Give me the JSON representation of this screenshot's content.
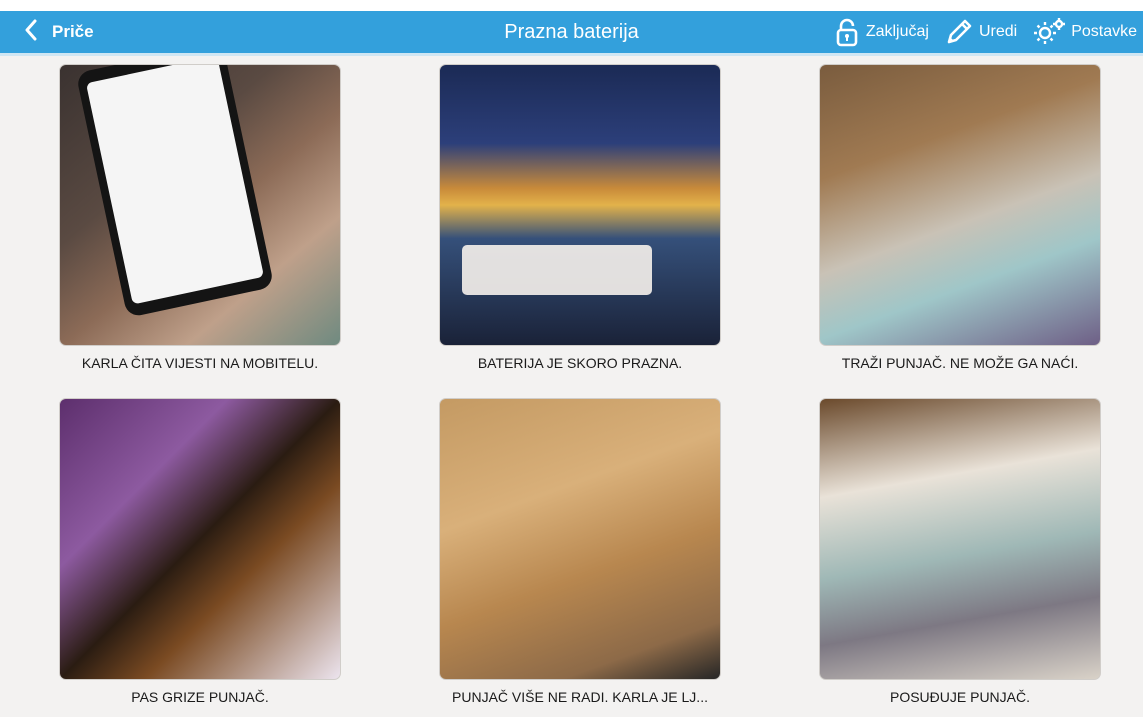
{
  "appbar": {
    "back_label": "Priče",
    "title": "Prazna baterija",
    "actions": {
      "lock_label": "Zaključaj",
      "edit_label": "Uredi",
      "settings_label": "Postavke"
    }
  },
  "colors": {
    "appbar": "#33a0dc",
    "background": "#f3f2f1"
  },
  "tiles": [
    {
      "caption": "KARLA ČITA VIJESTI NA MOBITELU."
    },
    {
      "caption": "BATERIJA JE SKORO PRAZNA."
    },
    {
      "caption": "TRAŽI PUNJAČ. NE MOŽE GA NAĆI."
    },
    {
      "caption": "PAS GRIZE PUNJAČ."
    },
    {
      "caption": "PUNJAČ VIŠE NE RADI. KARLA JE LJ..."
    },
    {
      "caption": "POSUĐUJE PUNJAČ."
    }
  ]
}
